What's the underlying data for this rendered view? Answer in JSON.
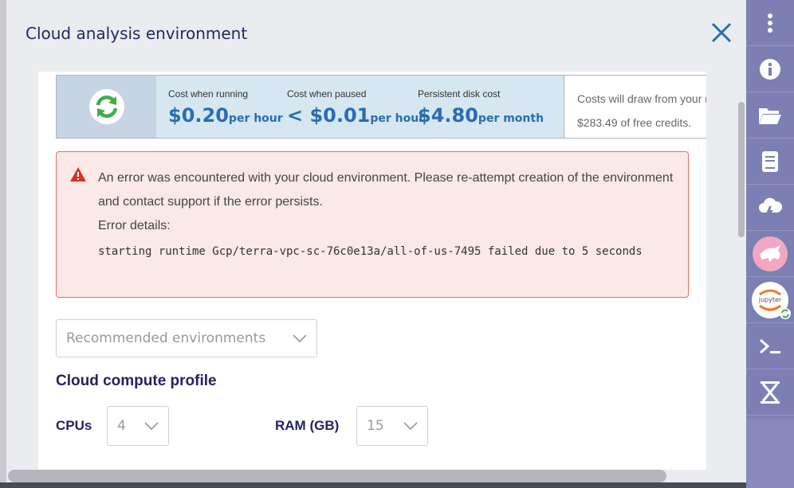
{
  "panel": {
    "title": "Cloud analysis environment"
  },
  "costs": {
    "running": {
      "label": "Cost when running",
      "value": "$0.20",
      "unit": "per hour"
    },
    "paused": {
      "label": "Cost when paused",
      "value": "< $0.01",
      "unit": "per hour"
    },
    "disk": {
      "label": "Persistent disk cost",
      "value": "$4.80",
      "unit": "per month"
    },
    "note_line1": "Costs will draw from your r",
    "note_line2": "$283.49 of free credits."
  },
  "error": {
    "message": "An error was encountered with your cloud environment. Please re-attempt creation of the environment and contact support if the error persists.",
    "details_label": "Error details:",
    "details": "starting runtime Gcp/terra-vpc-sc-76c0e13a/all-of-us-7495 failed due to 5 seconds"
  },
  "environments_select": {
    "value": "Recommended environments"
  },
  "compute_profile": {
    "title": "Cloud compute profile",
    "cpus_label": "CPUs",
    "cpus_value": "4",
    "ram_label": "RAM (GB)",
    "ram_value": "15"
  },
  "sidebar": {
    "jupyter_label": "jupyter",
    "items": [
      "more-icon",
      "info-icon",
      "folder-icon",
      "notebook-icon",
      "cloud-icon",
      "genomics-icon",
      "jupyter-icon",
      "terminal-icon",
      "workflow-icon"
    ]
  },
  "colors": {
    "accent": "#2a6db0",
    "sidebar": "#7b7fb4",
    "error_border": "#e0736b"
  }
}
